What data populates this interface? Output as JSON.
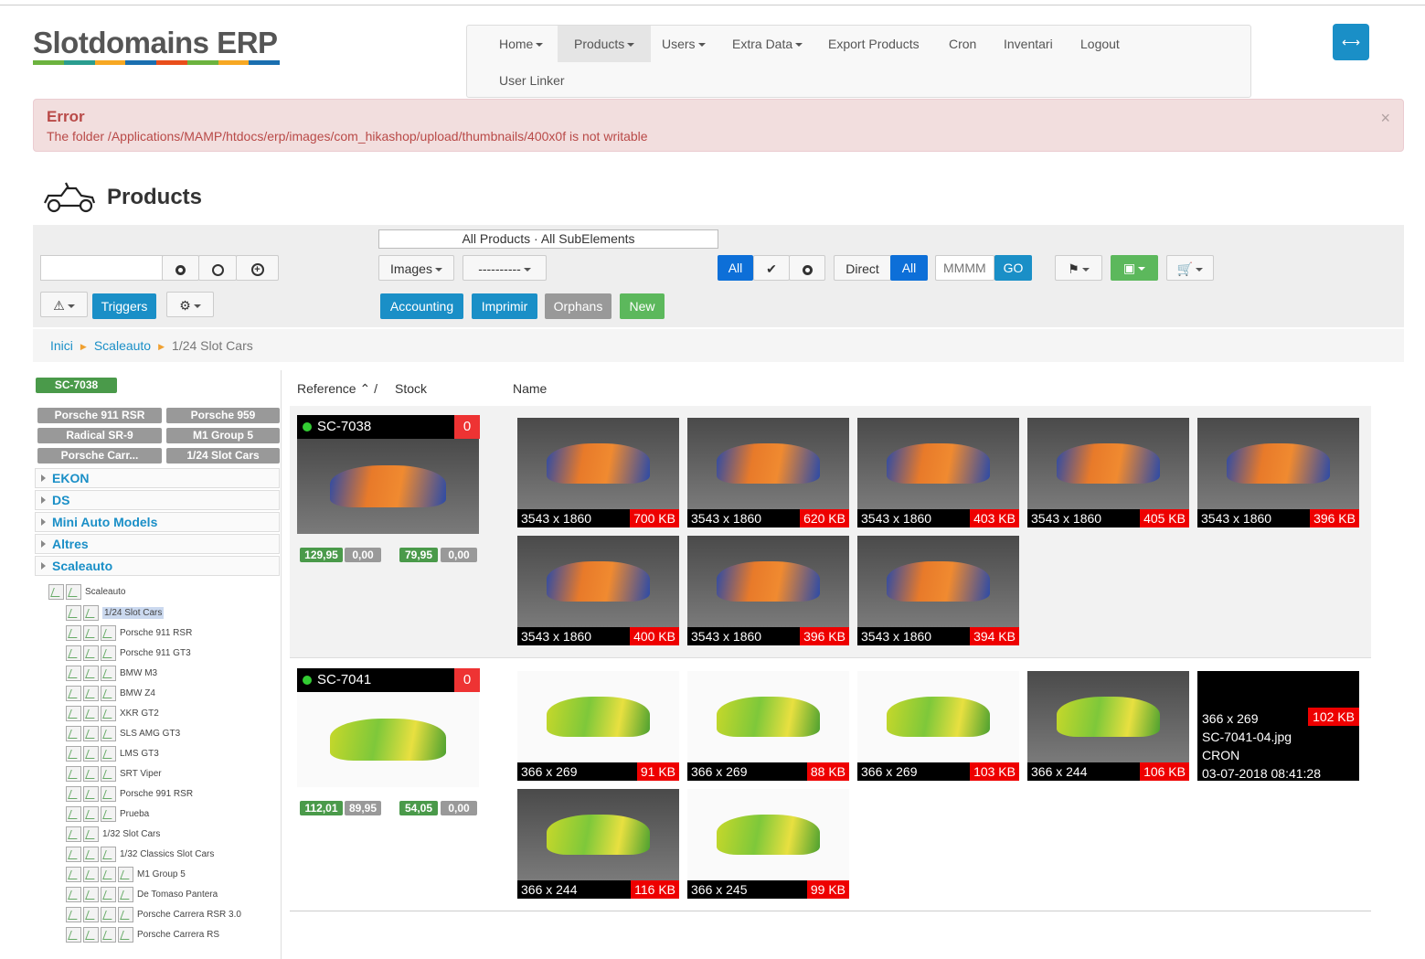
{
  "logo": {
    "text": "Slotdomains ERP",
    "colors": [
      "#6cb33e",
      "#2a9d8f",
      "#f7a823",
      "#1a6fb0",
      "#e94e1b",
      "#6cb33e",
      "#f7a823",
      "#1a6fb0"
    ]
  },
  "nav": {
    "items": [
      {
        "label": "Home",
        "dropdown": true
      },
      {
        "label": "Products",
        "dropdown": true,
        "active": true
      },
      {
        "label": "Users",
        "dropdown": true
      },
      {
        "label": "Extra Data",
        "dropdown": true
      },
      {
        "label": "Export Products",
        "dropdown": false
      },
      {
        "label": "Cron",
        "dropdown": false
      },
      {
        "label": "Inventari",
        "dropdown": false
      },
      {
        "label": "Logout",
        "dropdown": false
      },
      {
        "label": "User Linker",
        "dropdown": false
      }
    ],
    "expand_icon": "expand-horizontal-icon"
  },
  "alert": {
    "title": "Error",
    "message": "The folder /Applications/MAMP/htdocs/erp/images/com_hikashop/upload/thumbnails/400x0f is not writable",
    "close": "×"
  },
  "page": {
    "title": "Products",
    "icon": "kart-car-icon"
  },
  "toolbar": {
    "search_value": "",
    "filter_text": "All Products · All SubElements",
    "images_label": "Images",
    "dashes_label": "----------",
    "all_label": "All",
    "direct_label": "Direct",
    "all2_label": "All",
    "month_placeholder": "MMMM",
    "go_label": "GO",
    "triggers_label": "Triggers",
    "accounting_label": "Accounting",
    "imprimir_label": "Imprimir",
    "orphans_label": "Orphans",
    "new_label": "New"
  },
  "breadcrumb": [
    "Inici",
    "Scaleauto",
    "1/24 Slot Cars"
  ],
  "sidebar": {
    "selected_tag": "SC-7038",
    "tags": [
      "Porsche 911 RSR",
      "Porsche 959",
      "Radical SR-9",
      "M1 Group 5",
      "Porsche Carr...",
      "1/24 Slot Cars"
    ],
    "accordion": [
      "EKON",
      "DS",
      "Mini Auto Models",
      "Altres",
      "Scaleauto"
    ],
    "tree": [
      {
        "label": "Scaleauto",
        "depth": 0,
        "icons": 2
      },
      {
        "label": "1/24 Slot Cars",
        "depth": 1,
        "icons": 2,
        "selected": true
      },
      {
        "label": "Porsche 911 RSR",
        "depth": 1,
        "icons": 3
      },
      {
        "label": "Porsche 911 GT3",
        "depth": 1,
        "icons": 3
      },
      {
        "label": "BMW M3",
        "depth": 1,
        "icons": 3
      },
      {
        "label": "BMW Z4",
        "depth": 1,
        "icons": 3
      },
      {
        "label": "XKR GT2",
        "depth": 1,
        "icons": 3
      },
      {
        "label": "SLS AMG GT3",
        "depth": 1,
        "icons": 3
      },
      {
        "label": "LMS GT3",
        "depth": 1,
        "icons": 3
      },
      {
        "label": "SRT Viper",
        "depth": 1,
        "icons": 3
      },
      {
        "label": "Porsche 991 RSR",
        "depth": 1,
        "icons": 3
      },
      {
        "label": "Prueba",
        "depth": 1,
        "icons": 3
      },
      {
        "label": "1/32 Slot Cars",
        "depth": 1,
        "icons": 2
      },
      {
        "label": "1/32 Classics Slot Cars",
        "depth": 1,
        "icons": 3
      },
      {
        "label": "M1 Group 5",
        "depth": 1,
        "icons": 4
      },
      {
        "label": "De Tomaso Pantera",
        "depth": 1,
        "icons": 4
      },
      {
        "label": "Porsche Carrera RSR 3.0",
        "depth": 1,
        "icons": 4
      },
      {
        "label": "Porsche Carrera RS",
        "depth": 1,
        "icons": 4
      }
    ]
  },
  "columns": {
    "reference": "Reference",
    "stock": "Stock",
    "name": "Name"
  },
  "products": [
    {
      "ref": "SC-7038",
      "count": "0",
      "theme": "orange",
      "prices": [
        "129,95",
        "0,00",
        "79,95",
        "0,00"
      ],
      "images": [
        {
          "dims": "3543 x 1860",
          "size": "700 KB"
        },
        {
          "dims": "3543 x 1860",
          "size": "620 KB"
        },
        {
          "dims": "3543 x 1860",
          "size": "403 KB"
        },
        {
          "dims": "3543 x 1860",
          "size": "405 KB"
        },
        {
          "dims": "3543 x 1860",
          "size": "396 KB"
        },
        {
          "dims": "3543 x 1860",
          "size": "400 KB"
        },
        {
          "dims": "3543 x 1860",
          "size": "396 KB"
        },
        {
          "dims": "3543 x 1860",
          "size": "394 KB"
        }
      ]
    },
    {
      "ref": "SC-7041",
      "count": "0",
      "theme": "green",
      "prices": [
        "112,01",
        "89,95",
        "54,05",
        "0,00"
      ],
      "images": [
        {
          "dims": "366 x 269",
          "size": "91 KB"
        },
        {
          "dims": "366 x 269",
          "size": "88 KB"
        },
        {
          "dims": "366 x 269",
          "size": "103 KB"
        },
        {
          "dims": "366 x 244",
          "size": "106 KB",
          "dark": true
        },
        {
          "info": true,
          "dims": "366 x 269",
          "size": "102 KB",
          "file": "SC-7041-04.jpg",
          "source": "CRON",
          "date": "03-07-2018 08:41:28"
        },
        {
          "dims": "366 x 244",
          "size": "116 KB",
          "dark": true
        },
        {
          "dims": "366 x 245",
          "size": "99 KB"
        }
      ]
    }
  ]
}
